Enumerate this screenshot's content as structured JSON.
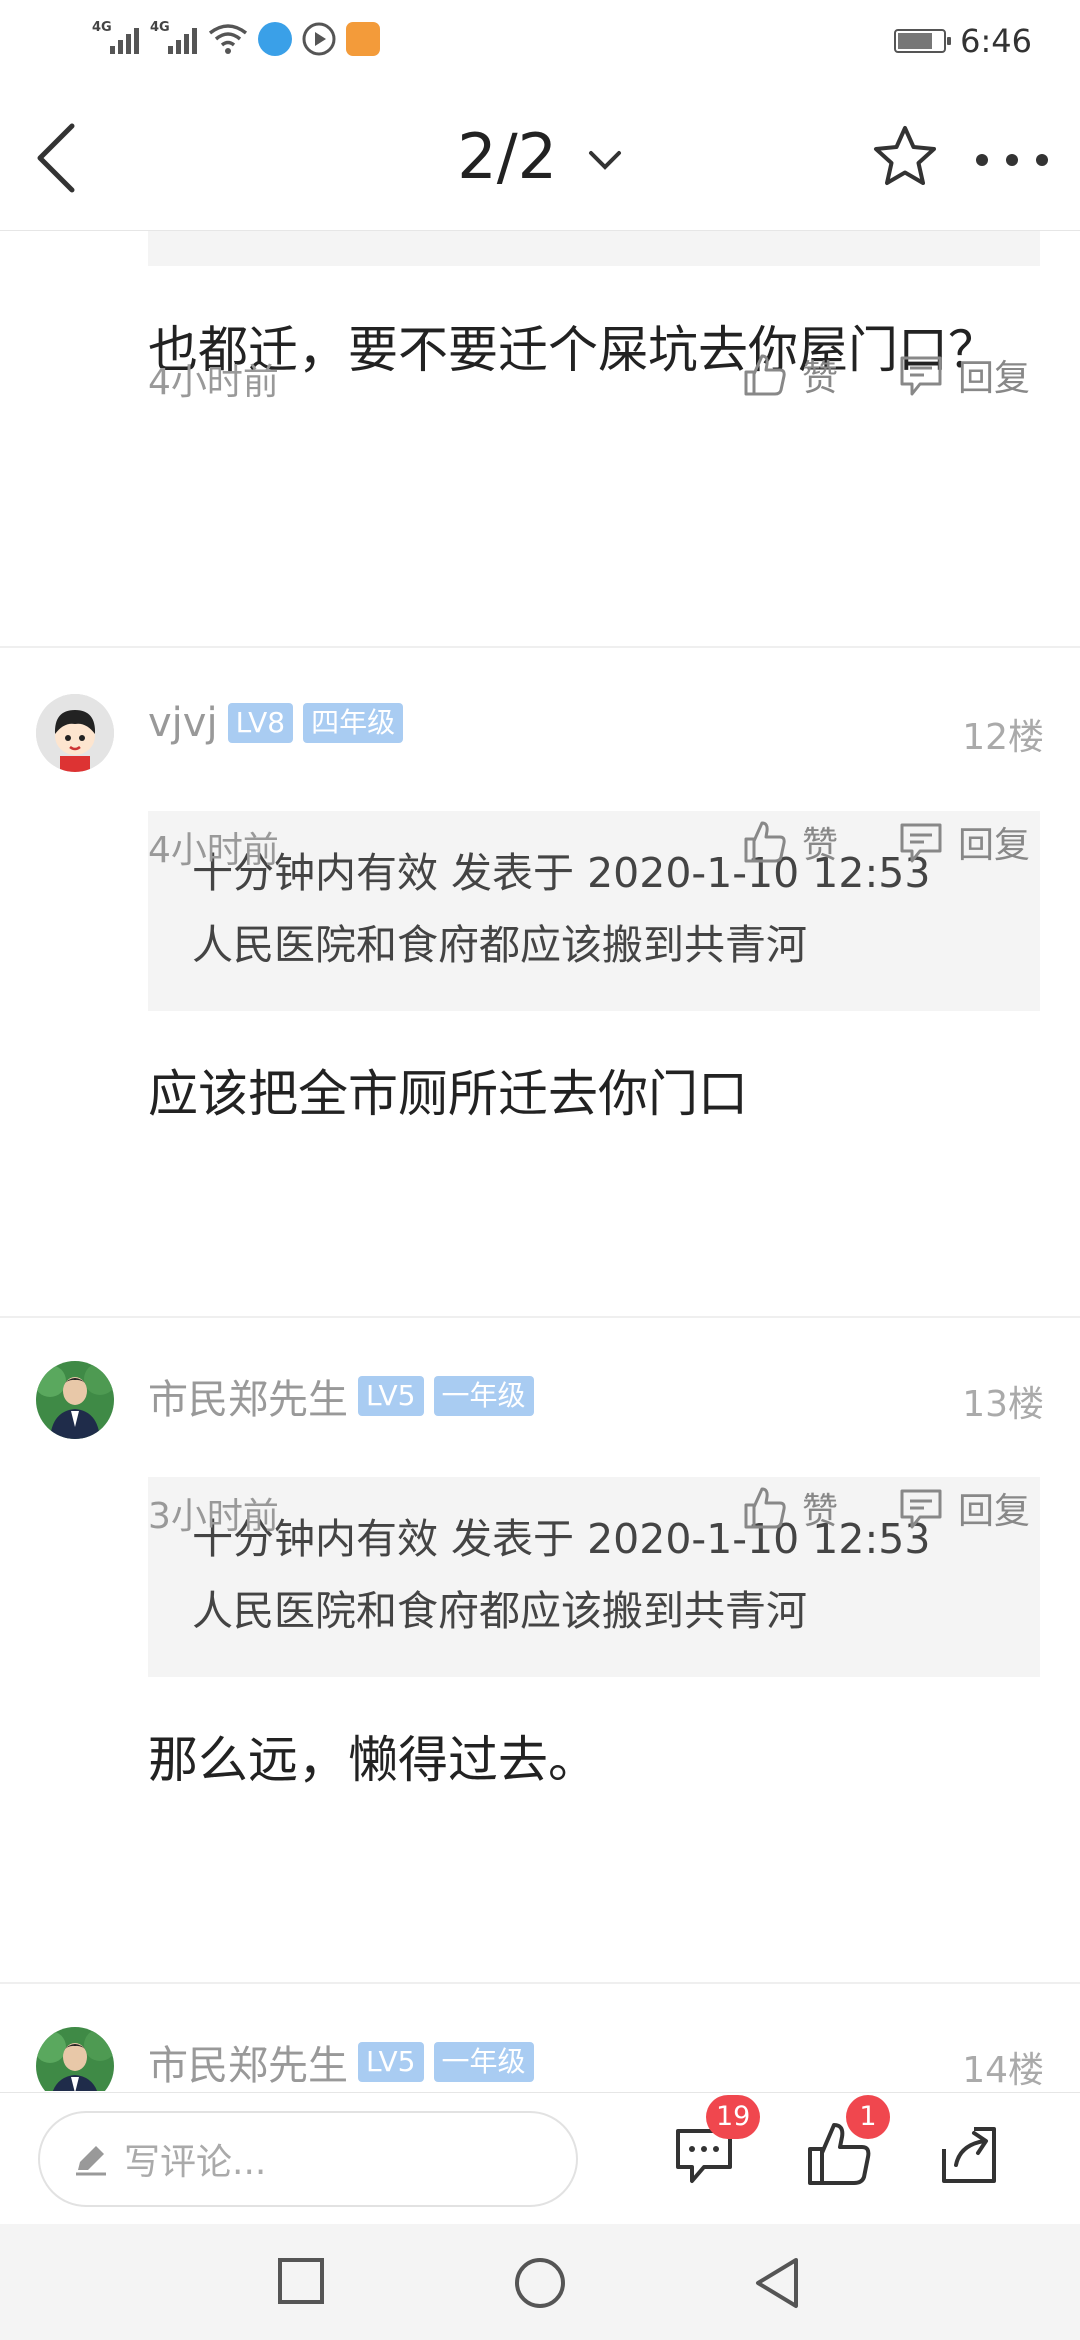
{
  "status_bar": {
    "network_1": "4G",
    "network_2": "4G",
    "time": "6:46"
  },
  "nav": {
    "page_indicator": "2/2"
  },
  "partial_comment": {
    "text": "也都迁，要不要迁个屎坑去你屋门口？",
    "time": "4小时前",
    "like_label": "赞",
    "reply_label": "回复"
  },
  "comments": [
    {
      "username": "vjvj",
      "level": "LV8",
      "grade": "四年级",
      "floor": "12楼",
      "quote_header": "十分钟内有效 发表于 2020-1-10 12:53",
      "quote_text": "人民医院和食府都应该搬到共青河",
      "text": "应该把全市厕所迁去你门口",
      "time": "4小时前",
      "like_label": "赞",
      "reply_label": "回复"
    },
    {
      "username": "市民郑先生",
      "level": "LV5",
      "grade": "一年级",
      "floor": "13楼",
      "quote_header": "十分钟内有效 发表于 2020-1-10 12:53",
      "quote_text": "人民医院和食府都应该搬到共青河",
      "text": "那么远，懒得过去。",
      "time": "3小时前",
      "like_label": "赞",
      "reply_label": "回复"
    },
    {
      "username": "市民郑先生",
      "level": "LV5",
      "grade": "一年级",
      "floor": "14楼"
    }
  ],
  "bottom_bar": {
    "placeholder": "写评论...",
    "comment_count": "19",
    "like_count": "1"
  },
  "colors": {
    "badge_bg": "#a9ccf2",
    "count_badge": "#f0474e",
    "quote_bg": "#f4f4f4"
  }
}
